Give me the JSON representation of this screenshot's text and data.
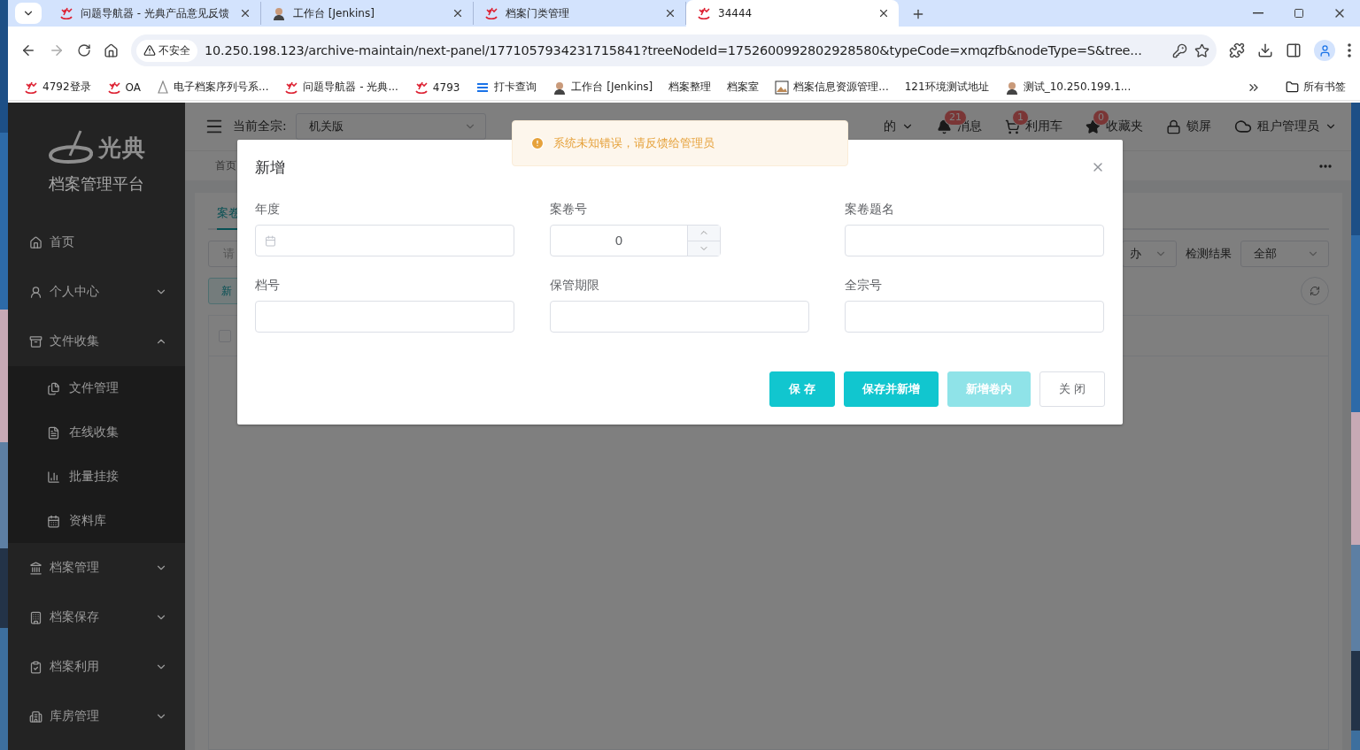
{
  "browser": {
    "tabs": [
      {
        "title": "问题导航器 - 光典产品意见反馈",
        "selected": false
      },
      {
        "title": "工作台 [Jenkins]",
        "selected": false
      },
      {
        "title": "档案门类管理",
        "selected": false
      },
      {
        "title": "34444",
        "selected": true
      }
    ],
    "security": "不安全",
    "url": "10.250.198.123/archive-maintain/next-panel/1771057934231715841?treeNodeId=1752600992802928580&typeCode=xmqzfb&nodeType=S&tree...",
    "bookmarks": [
      "4792登录",
      "OA",
      "电子档案序列号系...",
      "问题导航器 - 光典...",
      "4793",
      "打卡查询",
      "工作台 [Jenkins]",
      "档案整理",
      "档案室",
      "档案信息资源管理...",
      "121环境测试地址",
      "测试_10.250.199.1..."
    ],
    "all_bookmarks": "所有书签"
  },
  "sidebar": {
    "logo": "光典",
    "platform": "档案管理平台",
    "items": [
      {
        "label": "首页"
      },
      {
        "label": "个人中心",
        "expanded": false
      },
      {
        "label": "文件收集",
        "expanded": true,
        "children": [
          {
            "label": "文件管理"
          },
          {
            "label": "在线收集"
          },
          {
            "label": "批量挂接"
          },
          {
            "label": "资料库"
          }
        ]
      },
      {
        "label": "档案管理",
        "expanded": false
      },
      {
        "label": "档案保存",
        "expanded": false
      },
      {
        "label": "档案利用",
        "expanded": false
      },
      {
        "label": "库房管理",
        "expanded": false
      }
    ]
  },
  "header": {
    "fonds_label": "当前全宗:",
    "fonds_value": "机关版",
    "user_menu": "的",
    "actions": [
      {
        "label": "消息",
        "badge": "21"
      },
      {
        "label": "利用车",
        "badge": "1"
      },
      {
        "label": "收藏夹",
        "badge": "0"
      },
      {
        "label": "锁屏"
      }
    ],
    "account": "租户管理员"
  },
  "breadcrumb": "首页",
  "content": {
    "tab": {
      "label": "案卷",
      "selected": true
    },
    "search": {
      "placeholder": "请"
    },
    "filter_value": "办",
    "check_label": "检测结果",
    "check_value": "全部",
    "add_button": "新",
    "table": {
      "select_all": {
        "checked": false
      }
    }
  },
  "toast": {
    "message": "系统未知错误，请反馈给管理员"
  },
  "dialog": {
    "title": "新增",
    "fields": [
      {
        "label": "年度",
        "kind": "date"
      },
      {
        "label": "案卷号",
        "kind": "number",
        "value": "0"
      },
      {
        "label": "案卷题名",
        "kind": "text"
      },
      {
        "label": "档号",
        "kind": "text"
      },
      {
        "label": "保管期限",
        "kind": "text"
      },
      {
        "label": "全宗号",
        "kind": "text"
      }
    ],
    "buttons": [
      {
        "label": "保 存",
        "kind": "primary",
        "disabled": false
      },
      {
        "label": "保存并新增",
        "kind": "primary",
        "disabled": false
      },
      {
        "label": "新增卷内",
        "kind": "primary",
        "disabled": true
      },
      {
        "label": "关 闭",
        "kind": "plain",
        "disabled": false
      }
    ]
  }
}
